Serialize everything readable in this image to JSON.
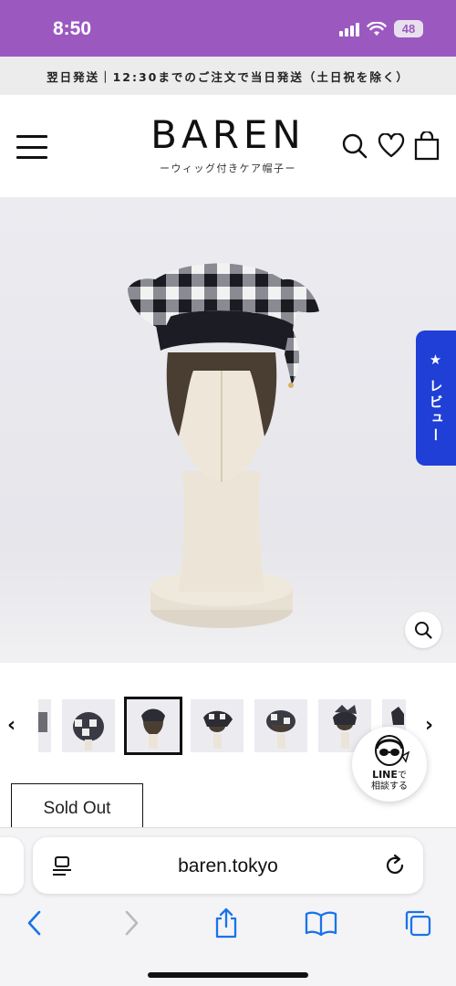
{
  "status_bar": {
    "time": "8:50",
    "battery": "48",
    "background": "#9b59c0"
  },
  "announcement": {
    "text": "翌日発送｜12:30までのご注文で当日発送（土日祝を除く）"
  },
  "header": {
    "logo": "BAREN",
    "tagline": "ーウィッグ付きケア帽子ー",
    "icons": [
      "menu-icon",
      "search-icon",
      "heart-icon",
      "bag-icon"
    ]
  },
  "hero": {
    "review_tab": "★ レビュー",
    "review_tab_color": "#1f3fd6",
    "zoom_icon": "zoom-icon"
  },
  "thumbnails": {
    "count": 7,
    "active_index": 2,
    "prev_label": "‹",
    "next_label": "›"
  },
  "line_badge": {
    "brand": "LINE",
    "suffix": "で",
    "line2": "相談する"
  },
  "product": {
    "button_label": "Sold Out"
  },
  "browser": {
    "url": "baren.tokyo",
    "toolbar_icons": [
      "back-icon",
      "forward-icon",
      "share-icon",
      "bookmarks-icon",
      "tabs-icon"
    ],
    "accent": "#1a73e8"
  }
}
